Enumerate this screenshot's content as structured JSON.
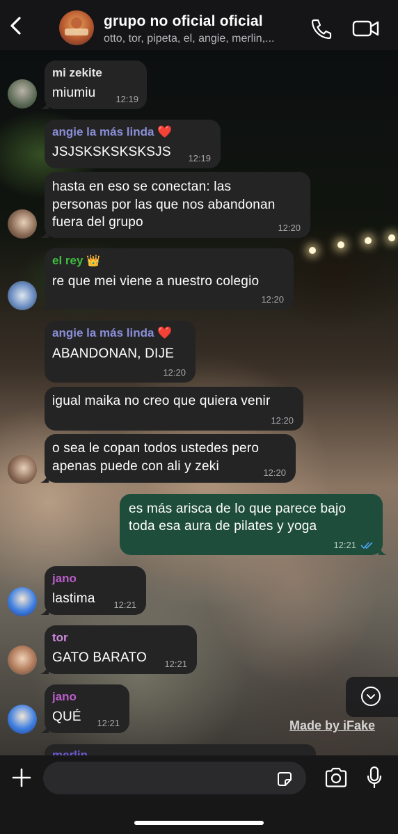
{
  "header": {
    "title": "grupo no oficial oficial",
    "members": "otto, tor, pipeta, el, angie, merlin,..."
  },
  "colors": {
    "incoming_bubble": "#242425",
    "outgoing_bubble": "#1f4d3b",
    "sender_zekite": "#e6e6e6",
    "sender_angie": "#8a8fd8",
    "sender_rey": "#3fbf3f",
    "sender_jano": "#b85ec8",
    "sender_tor": "#d08ae0",
    "read_ticks": "#4fa3f7"
  },
  "messages": [
    {
      "sender": "mi zekite",
      "lines": [
        "miumiu"
      ],
      "time": "12:19"
    },
    {
      "sender": "angie la más linda",
      "emoji": "❤️",
      "lines": [
        "JSJSKSKSKSKSJS"
      ],
      "time": "12:19"
    },
    {
      "lines": [
        "hasta en eso se conectan: las",
        "personas por las que nos abandonan",
        "fuera del grupo"
      ],
      "time": "12:20"
    },
    {
      "sender": "el rey",
      "emoji": "👑",
      "lines": [
        "re que mei viene a nuestro colegio"
      ],
      "time": "12:20"
    },
    {
      "sender": "angie la más linda",
      "emoji": "❤️",
      "lines": [
        "ABANDONAN, DIJE"
      ],
      "time": "12:20"
    },
    {
      "lines": [
        "igual maika no creo que quiera venir"
      ],
      "time": "12:20"
    },
    {
      "lines": [
        "o sea le copan todos ustedes pero",
        "apenas puede con ali y zeki"
      ],
      "time": "12:20"
    },
    {
      "outgoing": true,
      "lines": [
        "es más arisca de lo que parece bajo",
        "toda esa aura de pilates y yoga"
      ],
      "time": "12:21"
    },
    {
      "sender": "jano",
      "lines": [
        "lastima"
      ],
      "time": "12:21"
    },
    {
      "sender": "tor",
      "lines": [
        "GATO BARATO"
      ],
      "time": "12:21"
    },
    {
      "sender": "jano",
      "lines": [
        "QUÉ"
      ],
      "time": "12:21"
    }
  ],
  "partial_sender": "merlin",
  "watermark": "Made by iFake",
  "input": {
    "placeholder": ""
  },
  "icons": [
    "back-icon",
    "call-icon",
    "video-icon",
    "chevron-down-icon",
    "plus-icon",
    "sticker-icon",
    "camera-icon",
    "mic-icon",
    "read-ticks-icon"
  ]
}
